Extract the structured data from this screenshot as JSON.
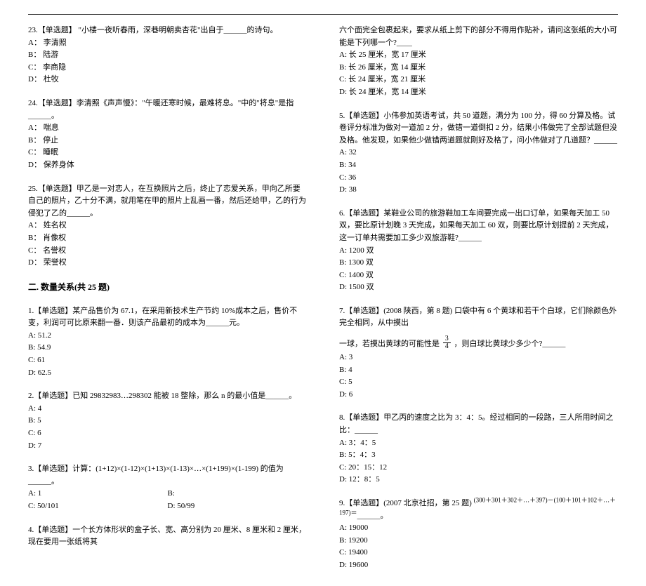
{
  "left": {
    "q23": {
      "stem": "23.【单选题】 \"小楼一夜听春雨，深巷明朝卖杏花\"出自于______的诗句。",
      "opts": [
        "A： 李清照",
        "B： 陆游",
        "C： 李商隐",
        "D： 杜牧"
      ]
    },
    "q24": {
      "stem": "24.【单选题】李清照《声声慢》：\"午暖还寒时候，最难将息。\"中的\"将息\"是指______。",
      "opts": [
        "A： 喘息",
        "B： 停止",
        "C： 睡眠",
        "D： 保养身体"
      ]
    },
    "q25": {
      "stem": "25.【单选题】甲乙是一对恋人，在互换照片之后，终止了恋爱关系，甲向乙所要自己的照片，乙十分不满，就用笔在甲的照片上乱画一番，然后还给甲，乙的行为侵犯了乙的______。",
      "opts": [
        "A： 姓名权",
        "B： 肖像权",
        "C： 名誉权",
        "D： 荣誉权"
      ]
    },
    "sectionTitle": "二. 数量关系(共 25 题)",
    "q1": {
      "stem": "1.【单选题】某产品售价为 67.1，在采用新技术生产节约 10%成本之后，售价不变，利润可可比原来翻一番．则该产品最初的成本为______元。",
      "opts": [
        "A: 51.2",
        "B: 54.9",
        "C: 61",
        "D: 62.5"
      ]
    },
    "q2": {
      "stem": "2.【单选题】已知 29832983…298302 能被 18 整除，那么 n 的最小值是______。",
      "opts": [
        "A: 4",
        "B: 5",
        "C: 6",
        "D: 7"
      ]
    },
    "q3": {
      "stem": "3.【单选题】计算：(1+12)×(1-12)×(1+13)×(1-13)×…×(1+199)×(1-199) 的值为______。",
      "opts": [
        "A: 1",
        "C: 50/101",
        "B:",
        "D: 50/99"
      ]
    },
    "q4": {
      "stem": "4.【单选题】一个长方体形状的盒子长、宽、高分别为 20 厘米、8 厘米和 2 厘米，现在要用一张纸将其"
    }
  },
  "right": {
    "q4cont": {
      "stem": "六个面完全包裹起来，要求从纸上剪下的部分不得用作贴补，请问这张纸的大小可能是下列哪一个?____",
      "opts": [
        "A: 长 25 厘米，宽 17 厘米",
        "B: 长 26 厘米，宽 14 厘米",
        "C: 长 24 厘米，宽 21 厘米",
        "D: 长 24 厘米，宽 14 厘米"
      ]
    },
    "q5": {
      "stem": "5.【单选题】小伟参加英语考试，共 50 道题，满分为 100 分，得 60 分算及格。试卷评分标准为做对一道加 2 分，做错一道倒扣 2 分，结果小伟做完了全部试题但没及格。他发现，如果他少做错两道题就刚好及格了，问小伟做对了几道题？______",
      "opts": [
        "A: 32",
        "B: 34",
        "C: 36",
        "D: 38"
      ]
    },
    "q6": {
      "stem": "6.【单选题】某鞋业公司的旅游鞋加工车间要完成一出口订单，如果每天加工 50 双，要比原计划晚 3 天完成，如果每天加工 60 双，则要比原计划提前 2 天完成，这一订单共需要加工多少双旅游鞋?______",
      "opts": [
        "A: 1200 双",
        "B: 1300 双",
        "C: 1400 双",
        "D: 1500 双"
      ]
    },
    "q7": {
      "line1": "7.【单选题】(2008 陕西，第 8 题) 口袋中有 6 个黄球和若干个白球，它们除颜色外完全相同，从中摸出",
      "line2a": "一球，若摸出黄球的可能性是",
      "fracNum": "3",
      "fracDen": "4",
      "line2b": "，则白球比黄球少多少个?______",
      "opts": [
        "A: 3",
        "B: 4",
        "C: 5",
        "D: 6"
      ]
    },
    "q8": {
      "stem": "8.【单选题】甲乙丙的速度之比为 3：4：5。经过相同的一段路，三人所用时间之比：______",
      "opts": [
        "A: 3：4：5",
        "B: 5：4：3",
        "C: 20：15：12",
        "D: 12：8：5"
      ]
    },
    "q9": {
      "stem_a": "9.【单选题】(2007 北京社招，第 25 题) ",
      "sup": "(300＋301＋302＋…＋397)－(100＋101＋102＋…＋197)＝",
      "stem_b": "______。",
      "opts": [
        "A: 19000",
        "B: 19200",
        "C: 19400",
        "D: 19600"
      ]
    }
  }
}
